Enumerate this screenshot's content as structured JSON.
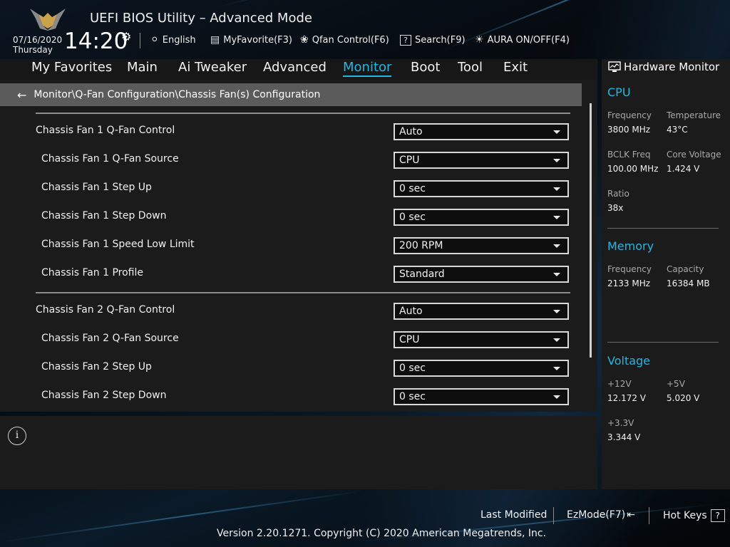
{
  "header": {
    "title": "UEFI BIOS Utility – Advanced Mode",
    "date": "07/16/2020",
    "day": "Thursday",
    "time": "14:20",
    "language": "English",
    "my_favorite": "MyFavorite(F3)",
    "qfan": "Qfan Control(F6)",
    "search": "Search(F9)",
    "aura": "AURA ON/OFF(F4)"
  },
  "nav": {
    "items": [
      "My Favorites",
      "Main",
      "Ai Tweaker",
      "Advanced",
      "Monitor",
      "Boot",
      "Tool",
      "Exit"
    ],
    "active": "Monitor"
  },
  "breadcrumb": "Monitor\\Q-Fan Configuration\\Chassis Fan(s) Configuration",
  "settings": [
    {
      "label": "Chassis Fan 1 Q-Fan Control",
      "value": "Auto"
    },
    {
      "label": "Chassis Fan 1 Q-Fan Source",
      "value": "CPU"
    },
    {
      "label": "Chassis Fan 1 Step Up",
      "value": "0 sec"
    },
    {
      "label": "Chassis Fan 1 Step Down",
      "value": "0 sec"
    },
    {
      "label": "Chassis Fan 1 Speed Low Limit",
      "value": "200 RPM"
    },
    {
      "label": "Chassis Fan 1 Profile",
      "value": "Standard"
    },
    {
      "label": "Chassis Fan 2 Q-Fan Control",
      "value": "Auto"
    },
    {
      "label": "Chassis Fan 2 Q-Fan Source",
      "value": "CPU"
    },
    {
      "label": "Chassis Fan 2 Step Up",
      "value": "0 sec"
    },
    {
      "label": "Chassis Fan 2 Step Down",
      "value": "0 sec"
    }
  ],
  "hw_monitor": {
    "title": "Hardware Monitor",
    "cpu": {
      "heading": "CPU",
      "frequency_label": "Frequency",
      "frequency": "3800 MHz",
      "temperature_label": "Temperature",
      "temperature": "43°C",
      "bclk_label": "BCLK Freq",
      "bclk": "100.00 MHz",
      "core_voltage_label": "Core Voltage",
      "core_voltage": "1.424 V",
      "ratio_label": "Ratio",
      "ratio": "38x"
    },
    "memory": {
      "heading": "Memory",
      "frequency_label": "Frequency",
      "frequency": "2133 MHz",
      "capacity_label": "Capacity",
      "capacity": "16384 MB"
    },
    "voltage": {
      "heading": "Voltage",
      "v12_label": "+12V",
      "v12": "12.172 V",
      "v5_label": "+5V",
      "v5": "5.020 V",
      "v33_label": "+3.3V",
      "v33": "3.344 V"
    }
  },
  "footer": {
    "last_modified": "Last Modified",
    "ezmode": "EzMode(F7)",
    "hotkeys": "Hot Keys",
    "hotkeys_glyph": "?",
    "copyright": "Version 2.20.1271. Copyright (C) 2020 American Megatrends, Inc."
  },
  "colors": {
    "accent": "#21b8e6",
    "panel": "#1b1b1b",
    "breadcrumb_bg": "#5b5b5b"
  },
  "icons": {
    "info": "i"
  }
}
